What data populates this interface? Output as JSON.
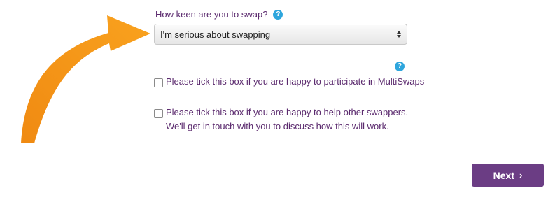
{
  "swap_keenness": {
    "question": "How keen are you to swap?",
    "help_icon_glyph": "?",
    "selected_value": "I'm serious about swapping"
  },
  "options_help": {
    "help_icon_glyph": "?"
  },
  "multiswaps": {
    "label": "Please tick this box if you are happy to participate in MultiSwaps",
    "checked": false
  },
  "help_swappers": {
    "label": "Please tick this box if you are happy to help other swappers. We'll get in touch with you to discuss how this will work.",
    "checked": false
  },
  "actions": {
    "next_label": "Next",
    "next_chevron": "›"
  },
  "annotation": {
    "icon": "curved-arrow-icon",
    "color": "#f7941d"
  },
  "colors": {
    "label_text": "#5b2a6e",
    "help_icon": "#2ea6dd",
    "button_background": "#6b3d84",
    "button_text": "#ffffff"
  }
}
